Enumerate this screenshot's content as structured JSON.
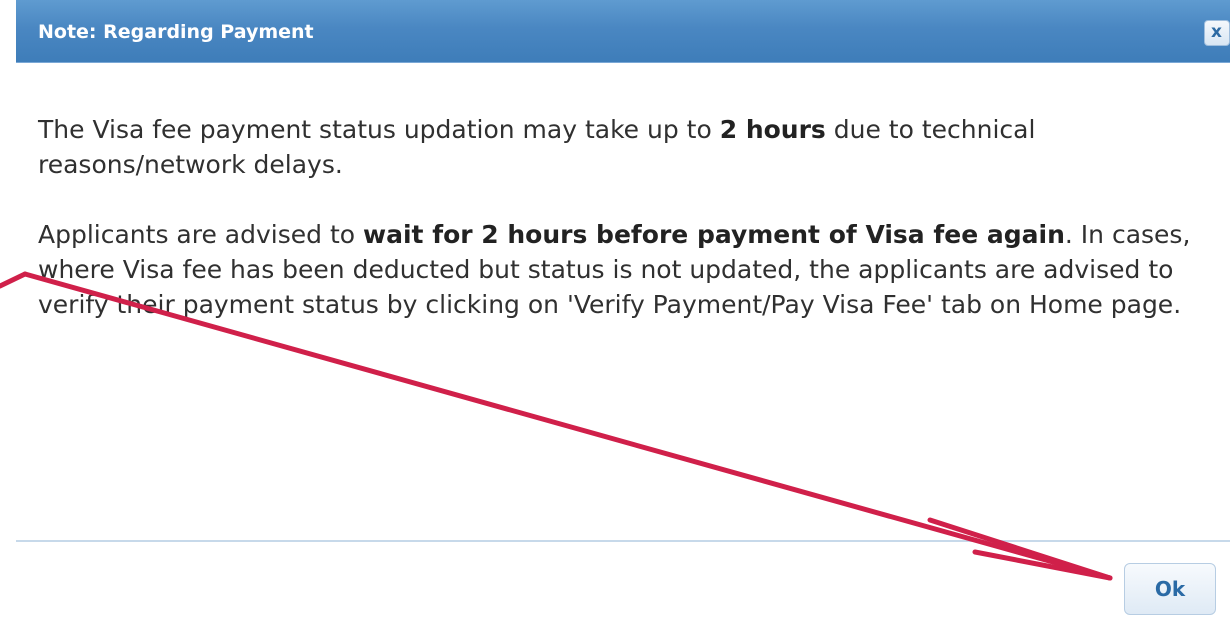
{
  "dialog": {
    "title": "Note: Regarding Payment",
    "close_label": "x",
    "paragraph1": {
      "text_before": "The Visa fee payment status updation may take up to ",
      "bold": "2 hours",
      "text_after": " due to technical reasons/network delays."
    },
    "paragraph2": {
      "text_before": "Applicants are advised to ",
      "bold": "wait for 2 hours before payment of Visa fee again",
      "text_after": ". In cases, where Visa fee has been deducted but status is not updated, the applicants are advised to verify their payment status by clicking on 'Verify Payment/Pay Visa Fee' tab on Home page."
    },
    "ok_label": "Ok"
  },
  "colors": {
    "titlebar": "#4a87c2",
    "annotation_arrow": "#d0204a",
    "button_text": "#2a6aa5"
  },
  "annotation": {
    "icon": "arrow-annotation"
  }
}
